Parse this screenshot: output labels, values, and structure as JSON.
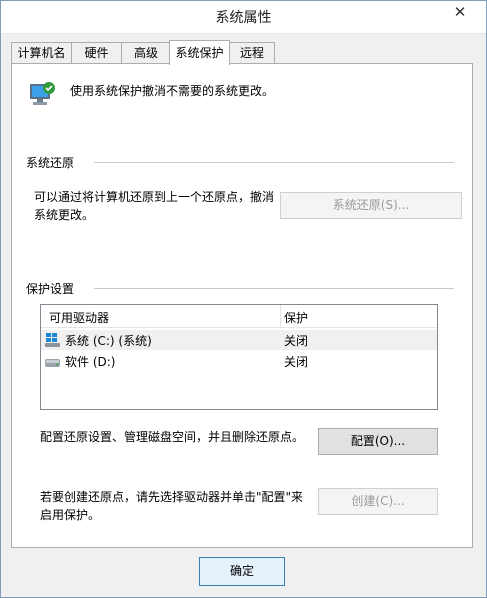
{
  "window": {
    "title": "系统属性",
    "close_glyph": "✕"
  },
  "tabs": [
    {
      "label": "计算机名"
    },
    {
      "label": "硬件"
    },
    {
      "label": "高级"
    },
    {
      "label": "系统保护"
    },
    {
      "label": "远程"
    }
  ],
  "header": {
    "description": "使用系统保护撤消不需要的系统更改。"
  },
  "restore": {
    "section_label": "系统还原",
    "text_line1": "可以通过将计算机还原到上一个还原点，撤消",
    "text_line2": "系统更改。",
    "button": "系统还原(S)..."
  },
  "protection": {
    "section_label": "保护设置",
    "columns": {
      "drive": "可用驱动器",
      "protection": "保护"
    },
    "drives": [
      {
        "name": "系统 (C:) (系统)",
        "protection": "关闭",
        "icon": "windows-drive-icon"
      },
      {
        "name": "软件 (D:)",
        "protection": "关闭",
        "icon": "disk-drive-icon"
      }
    ]
  },
  "configure": {
    "text": "配置还原设置、管理磁盘空间，并且删除还原点。",
    "button": "配置(O)..."
  },
  "create": {
    "text_line1": "若要创建还原点，请先选择驱动器并单击\"配置\"来",
    "text_line2": "启用保护。",
    "button": "创建(C)..."
  },
  "footer": {
    "ok_button": "确定"
  },
  "colors": {
    "accent": "#3c7fb1",
    "windows_blue": "#1e88d8",
    "disabled_text": "#9a9a9a"
  }
}
